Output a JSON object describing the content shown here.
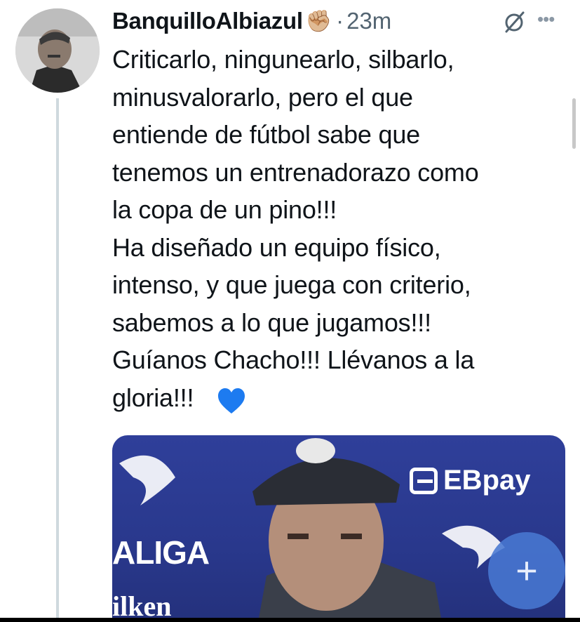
{
  "tweet": {
    "author": "BanquilloAlbiazul",
    "author_badge_icon": "raised-fist-emoji",
    "separator": "·",
    "time": "23m",
    "text": "Criticarlo, ningunearlo, silbarlo,\nminusvalorarlo, pero el que\nentiende de fútbol sabe que\ntenemos un entrenadorazo como\nla copa de un pino!!!\nHa diseñado un equipo físico,\nintenso, y que juega con criterio,\nsabemos a lo que jugamos!!!\nGuíanos Chacho!!! Llévanos a la\ngloria!!!",
    "trailing_emoji": "blue-heart",
    "media": {
      "sponsor_logo_text": "EBpay",
      "league_logo_text": "ALIGA",
      "other_logo_text": "ilken"
    }
  },
  "actions": {
    "compose_label": "+"
  },
  "colors": {
    "secondary_text": "#536471",
    "thread_line": "#cfd9de",
    "fab": "#4878d2",
    "media_background": "#2f3f9a"
  }
}
